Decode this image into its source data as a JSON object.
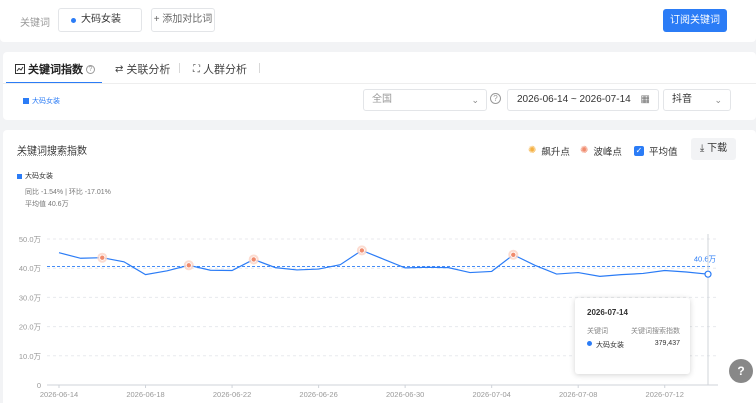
{
  "keyword_bar": {
    "label": "关键词",
    "chip": "大码女装",
    "add_compare": "+ 添加对比词",
    "subscribe": "订阅关键词"
  },
  "tabs": [
    {
      "label": "关键词指数",
      "icon": "chart-square-icon",
      "active": true
    },
    {
      "label": "关联分析",
      "icon": "link-arrows-icon",
      "active": false
    },
    {
      "label": "人群分析",
      "icon": "person-scan-icon",
      "active": false
    }
  ],
  "filters": {
    "series_tag": "大码女装",
    "region": "全国",
    "date_range": "2026-06-14 ~ 2026-07-14",
    "platform": "抖音"
  },
  "chart_header": {
    "title": "关键词搜索指数",
    "legend_rise": "飙升点",
    "legend_peak": "波峰点",
    "legend_avg": "平均值",
    "download": "下载"
  },
  "series_summary": {
    "name": "大码女装",
    "yoy_mom": "同比 -1.54% | 环比 -17.01%",
    "average": "平均值 40.6万"
  },
  "tooltip": {
    "date": "2026-07-14",
    "col1": "关键词",
    "col2": "关键词搜索指数",
    "name": "大码女装",
    "value": "379,437"
  },
  "colors": {
    "accent": "#2b7cf6",
    "rise": "#f5b041",
    "peak": "#f08a6c"
  },
  "chart_data": {
    "type": "line",
    "title": "关键词搜索指数",
    "y_ticks": [
      "0",
      "10.0万",
      "20.0万",
      "30.0万",
      "40.0万",
      "50.0万"
    ],
    "ylim": [
      0,
      500000
    ],
    "x_tick_labels": [
      "2026-06-14",
      "2026-06-18",
      "2026-06-22",
      "2026-06-26",
      "2026-06-30",
      "2026-07-04",
      "2026-07-08",
      "2026-07-12"
    ],
    "x": [
      "2026-06-14",
      "2026-06-15",
      "2026-06-16",
      "2026-06-17",
      "2026-06-18",
      "2026-06-19",
      "2026-06-20",
      "2026-06-21",
      "2026-06-22",
      "2026-06-23",
      "2026-06-24",
      "2026-06-25",
      "2026-06-26",
      "2026-06-27",
      "2026-06-28",
      "2026-06-29",
      "2026-06-30",
      "2026-07-01",
      "2026-07-02",
      "2026-07-03",
      "2026-07-04",
      "2026-07-05",
      "2026-07-06",
      "2026-07-07",
      "2026-07-08",
      "2026-07-09",
      "2026-07-10",
      "2026-07-11",
      "2026-07-12",
      "2026-07-13",
      "2026-07-14"
    ],
    "series": [
      {
        "name": "大码女装",
        "values": [
          453000,
          434000,
          436000,
          422000,
          378000,
          391000,
          410000,
          393000,
          392000,
          430000,
          402000,
          394000,
          397000,
          412000,
          461000,
          431000,
          401000,
          403000,
          402000,
          385000,
          389000,
          446000,
          410000,
          380000,
          385000,
          372000,
          378000,
          382000,
          392000,
          387000,
          379437
        ]
      }
    ],
    "peak_points": [
      "2026-06-16",
      "2026-06-20",
      "2026-06-23",
      "2026-06-28",
      "2026-07-05"
    ],
    "average": 406000,
    "average_label": "40.6万",
    "grid": true
  }
}
